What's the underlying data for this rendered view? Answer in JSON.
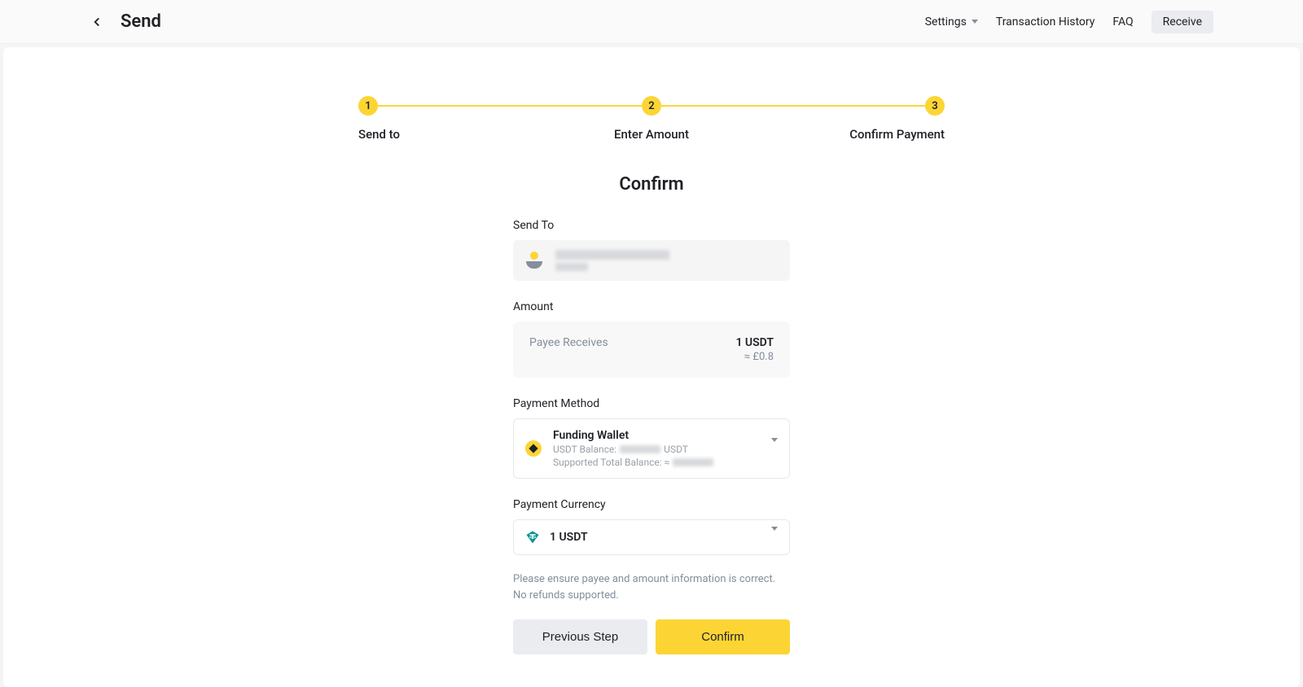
{
  "header": {
    "title": "Send",
    "settings": "Settings",
    "history": "Transaction History",
    "faq": "FAQ",
    "receive": "Receive"
  },
  "stepper": {
    "step1_num": "1",
    "step1_label": "Send to",
    "step2_num": "2",
    "step2_label": "Enter Amount",
    "step3_num": "3",
    "step3_label": "Confirm Payment"
  },
  "section": {
    "heading": "Confirm",
    "sendto_label": "Send To",
    "amount_label": "Amount",
    "payee_receives_label": "Payee Receives",
    "amount_value": "1 USDT",
    "amount_approx": "≈ £0.8",
    "method_label": "Payment Method",
    "method_title": "Funding Wallet",
    "method_balance_prefix": "USDT Balance:",
    "method_balance_suffix": "USDT",
    "method_supported_prefix": "Supported Total Balance: ≈",
    "currency_label": "Payment Currency",
    "currency_value": "1 USDT",
    "warning": "Please ensure payee and amount information is correct. No refunds supported.",
    "prev_button": "Previous Step",
    "confirm_button": "Confirm"
  }
}
